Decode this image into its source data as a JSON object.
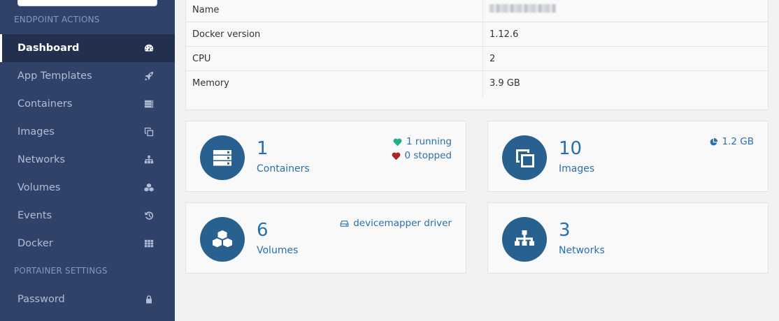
{
  "sidebar": {
    "search_placeholder": "",
    "sections": [
      {
        "title": "ENDPOINT ACTIONS"
      },
      {
        "title": "PORTAINER SETTINGS"
      }
    ],
    "items": [
      {
        "label": "Dashboard",
        "icon": "dashboard-icon",
        "active": true
      },
      {
        "label": "App Templates",
        "icon": "rocket-icon"
      },
      {
        "label": "Containers",
        "icon": "server-icon"
      },
      {
        "label": "Images",
        "icon": "clone-icon"
      },
      {
        "label": "Networks",
        "icon": "sitemap-icon"
      },
      {
        "label": "Volumes",
        "icon": "cubes-icon"
      },
      {
        "label": "Events",
        "icon": "history-icon"
      },
      {
        "label": "Docker",
        "icon": "grid-icon"
      },
      {
        "label": "Password",
        "icon": "lock-icon"
      }
    ]
  },
  "info": {
    "rows": [
      {
        "key": "Name",
        "value": ""
      },
      {
        "key": "Docker version",
        "value": "1.12.6"
      },
      {
        "key": "CPU",
        "value": "2"
      },
      {
        "key": "Memory",
        "value": "3.9 GB"
      }
    ]
  },
  "cards": {
    "containers": {
      "count": "1",
      "title": "Containers",
      "running": "1 running",
      "stopped": "0 stopped"
    },
    "images": {
      "count": "10",
      "title": "Images",
      "size": "1.2 GB"
    },
    "volumes": {
      "count": "6",
      "title": "Volumes",
      "driver": "devicemapper driver"
    },
    "networks": {
      "count": "3",
      "title": "Networks"
    }
  },
  "colors": {
    "sidebar_bg": "#30426a",
    "sidebar_active_bg": "#22304e",
    "accent": "#286090",
    "link": "#2a6fab",
    "running": "#23ae89",
    "stopped": "#ae2323"
  }
}
